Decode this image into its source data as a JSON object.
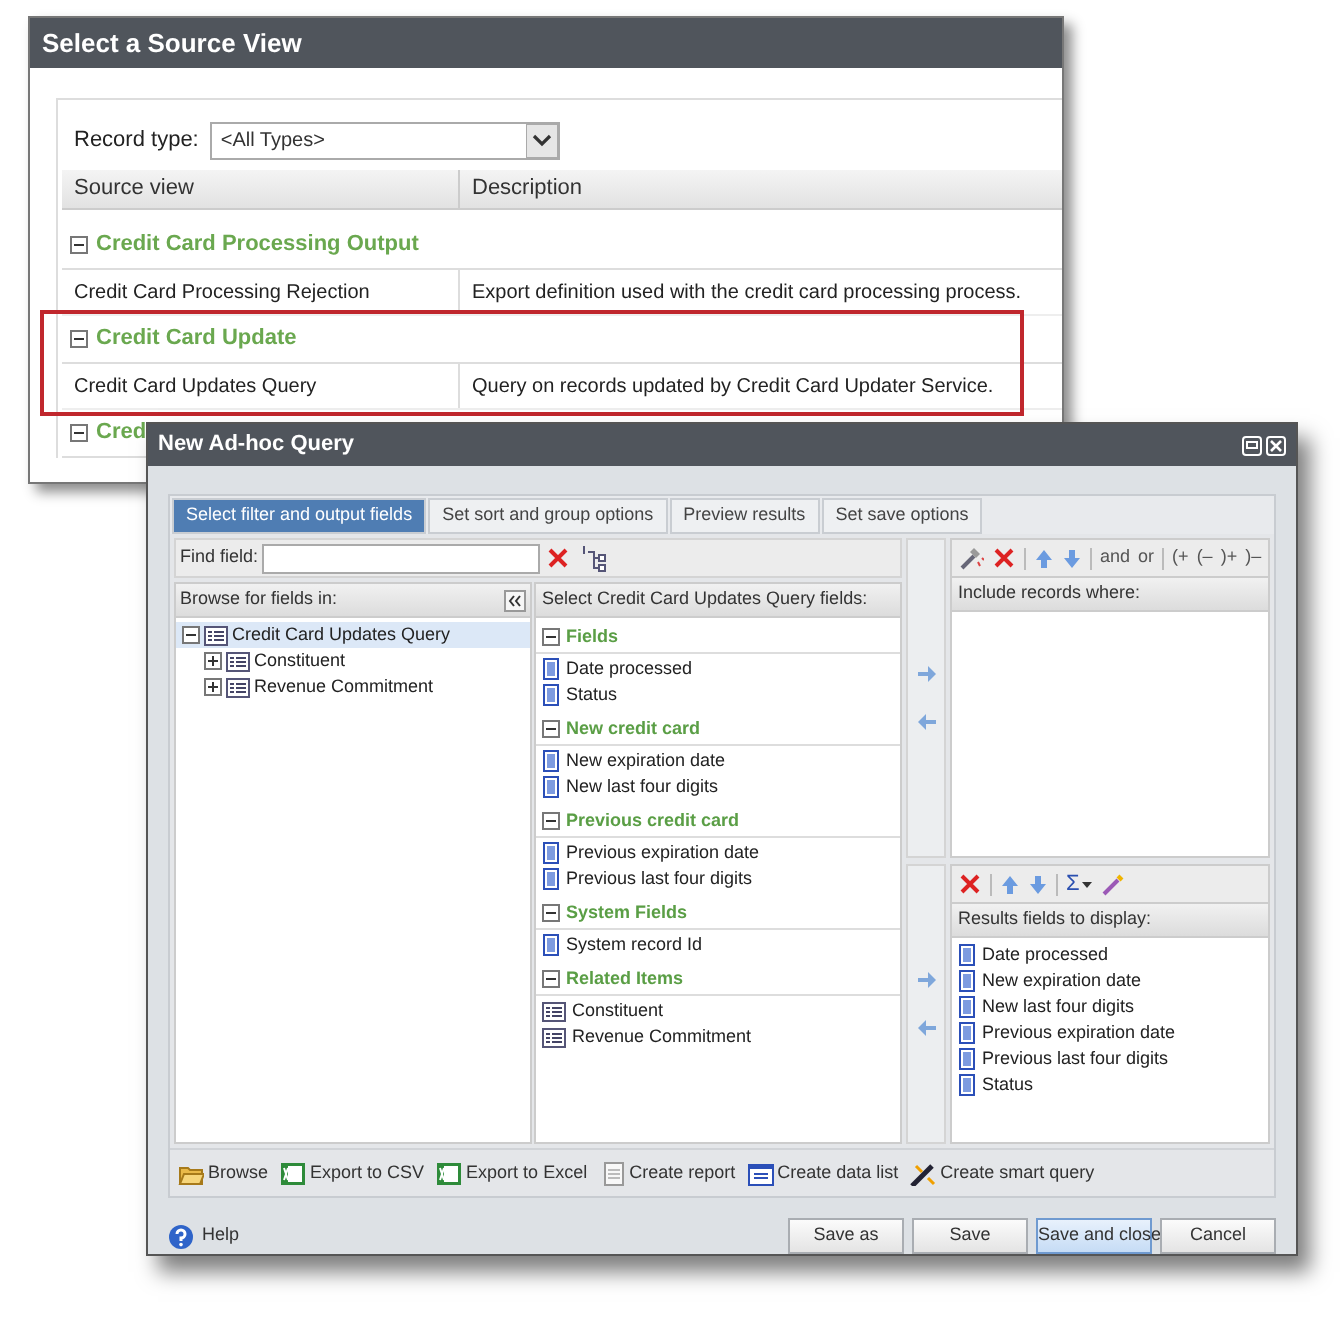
{
  "source_view_window": {
    "title": "Select a Source View",
    "record_type": {
      "label": "Record type:",
      "value": "<All Types>"
    },
    "columns": [
      "Source view",
      "Description"
    ],
    "groups": [
      {
        "name": "Credit Card Processing Output",
        "expanded": true,
        "highlighted": false,
        "rows": [
          {
            "source_view": "Credit Card Processing Rejection",
            "description": "Export definition used with the credit card processing process."
          }
        ]
      },
      {
        "name": "Credit Card Update",
        "expanded": true,
        "highlighted": true,
        "rows": [
          {
            "source_view": "Credit Card Updates Query",
            "description": "Query on records updated by Credit Card Updater Service."
          }
        ]
      },
      {
        "name": "Cred",
        "expanded": true,
        "highlighted": false
      }
    ]
  },
  "query_window": {
    "title": "New Ad-hoc Query",
    "tabs": [
      {
        "label": "Select filter and output fields",
        "selected": true
      },
      {
        "label": "Set sort and group options",
        "selected": false
      },
      {
        "label": "Preview results",
        "selected": false
      },
      {
        "label": "Set save options",
        "selected": false
      }
    ],
    "find_field": {
      "label": "Find field:"
    },
    "browse_panel": {
      "header": "Browse for fields in:",
      "tree": [
        {
          "label": "Credit Card Updates Query",
          "expanded": true,
          "selected": true,
          "children": [
            {
              "label": "Constituent",
              "expanded": false,
              "selected": false
            },
            {
              "label": "Revenue Commitment",
              "expanded": false,
              "selected": false
            }
          ]
        }
      ]
    },
    "fields_panel": {
      "header": "Select Credit Card Updates Query fields:",
      "groups": [
        {
          "name": "Fields",
          "items": [
            {
              "label": "Date processed",
              "kind": "field"
            },
            {
              "label": "Status",
              "kind": "field"
            }
          ]
        },
        {
          "name": "New credit card",
          "items": [
            {
              "label": "New expiration date",
              "kind": "field"
            },
            {
              "label": "New last four digits",
              "kind": "field"
            }
          ]
        },
        {
          "name": "Previous credit card",
          "items": [
            {
              "label": "Previous expiration date",
              "kind": "field"
            },
            {
              "label": "Previous last four digits",
              "kind": "field"
            }
          ]
        },
        {
          "name": "System Fields",
          "items": [
            {
              "label": "System record Id",
              "kind": "field"
            }
          ]
        },
        {
          "name": "Related Items",
          "items": [
            {
              "label": "Constituent",
              "kind": "node"
            },
            {
              "label": "Revenue Commitment",
              "kind": "node"
            }
          ]
        }
      ]
    },
    "filter_panel": {
      "operators": [
        "and",
        "or",
        "(+",
        "(–",
        ")+",
        ")–"
      ],
      "header": "Include records where:"
    },
    "results_panel": {
      "sum_label": "Σ",
      "header": "Results fields to display:",
      "items": [
        "Date processed",
        "New expiration date",
        "New last four digits",
        "Previous expiration date",
        "Previous last four digits",
        "Status"
      ]
    },
    "actions": [
      "Browse",
      "Export to CSV",
      "Export to Excel",
      "Create report",
      "Create data list",
      "Create smart query"
    ],
    "help": "Help",
    "buttons": [
      {
        "label": "Save as",
        "default": false
      },
      {
        "label": "Save",
        "default": false
      },
      {
        "label": "Save and close",
        "default": true
      },
      {
        "label": "Cancel",
        "default": false
      }
    ]
  }
}
